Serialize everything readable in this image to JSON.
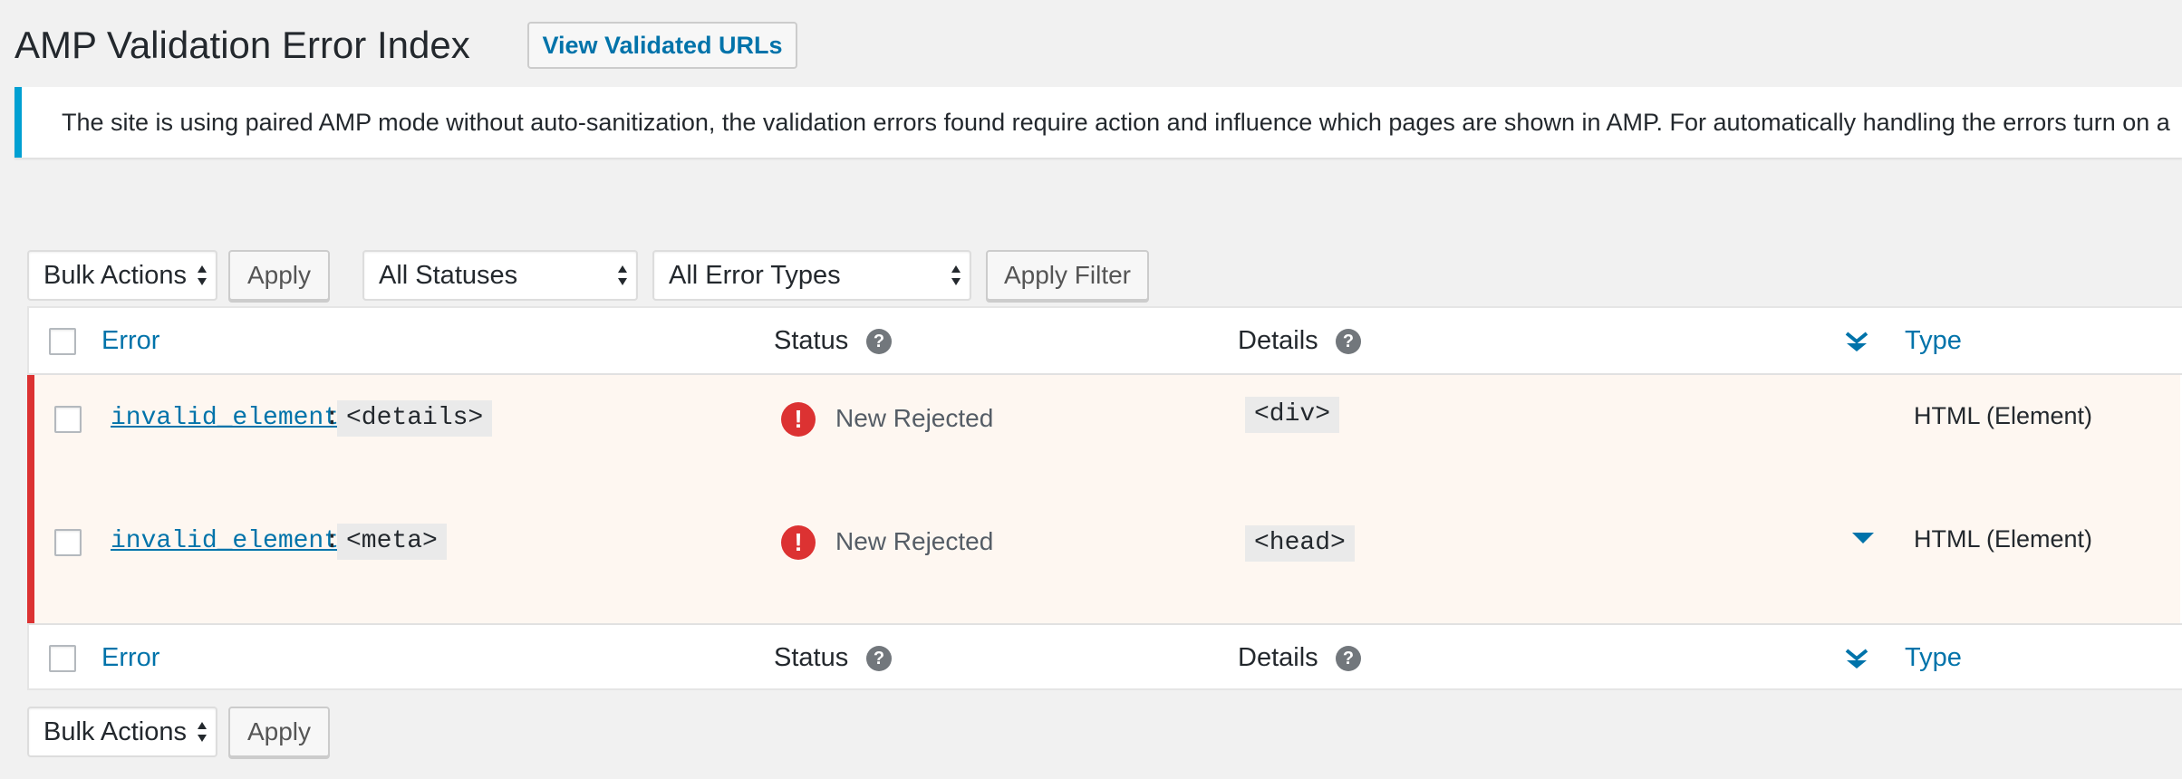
{
  "header": {
    "title": "AMP Validation Error Index",
    "view_button": "View Validated URLs"
  },
  "notice": {
    "text": "The site is using paired AMP mode without auto-sanitization, the validation errors found require action and influence which pages are shown in AMP. For automatically handling the errors turn on a"
  },
  "top_controls": {
    "bulk_actions": "Bulk Actions",
    "apply": "Apply",
    "status_filter": "All Statuses",
    "type_filter": "All Error Types",
    "apply_filter": "Apply Filter"
  },
  "columns": {
    "error": "Error",
    "status": "Status",
    "details": "Details",
    "type": "Type",
    "help_glyph": "?"
  },
  "rows": [
    {
      "error_code": "invalid_element",
      "separator": ":",
      "element": "<details>",
      "status_icon": "!",
      "status": "New Rejected",
      "details": "<div>",
      "type": "HTML (Element)"
    },
    {
      "error_code": "invalid_element",
      "separator": ":",
      "element": "<meta>",
      "status_icon": "!",
      "status": "New Rejected",
      "details": "<head>",
      "type": "HTML (Element)"
    }
  ],
  "bottom_controls": {
    "bulk_actions": "Bulk Actions",
    "apply": "Apply"
  },
  "colors": {
    "link": "#0073aa",
    "notice_border": "#00a0d2",
    "error_accent": "#dc3232",
    "row_background": "#fef7f1"
  },
  "icons": {
    "help": "question-circle-icon",
    "status": "error-circle-icon",
    "expand_all": "double-chevron-down-icon",
    "expand_row": "triangle-down-icon",
    "select_arrows": "up-down-arrows-icon"
  }
}
